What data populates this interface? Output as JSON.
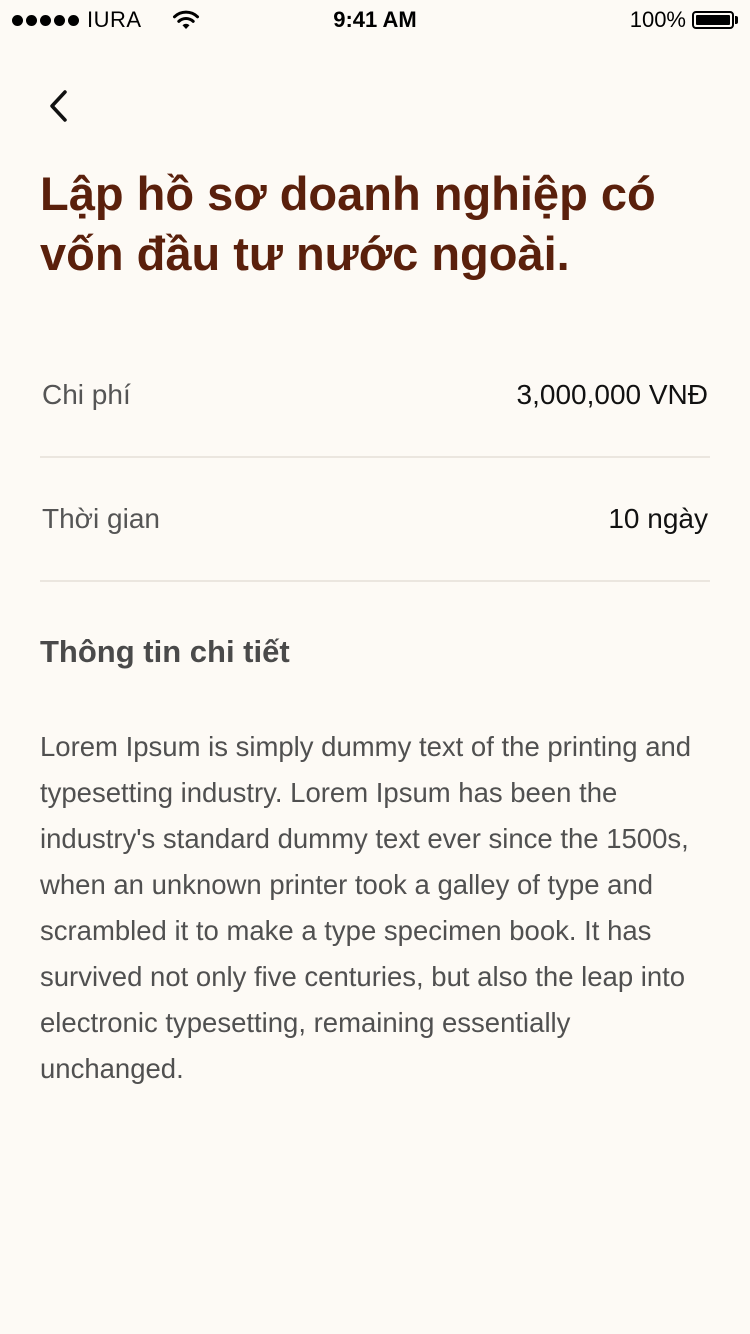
{
  "status_bar": {
    "carrier": "IURA",
    "time": "9:41 AM",
    "battery": "100%"
  },
  "icons": {
    "back": "chevron-left-icon",
    "signal": "signal-dots-icon",
    "wifi": "wifi-icon",
    "battery": "battery-icon"
  },
  "colors": {
    "title": "#5a200c",
    "background": "#fdfaf5",
    "divider": "#ebe6df"
  },
  "page": {
    "title": "Lập hồ sơ doanh nghiệp có vốn đầu tư nước ngoài."
  },
  "info": {
    "cost_label": "Chi phí",
    "cost_value": "3,000,000 VNĐ",
    "time_label": "Thời gian",
    "time_value": "10 ngày"
  },
  "details": {
    "heading": "Thông tin chi tiết",
    "body": "Lorem Ipsum is simply dummy text of the printing and typesetting industry. Lorem Ipsum has been the industry's standard dummy text ever since the 1500s, when an unknown printer took a galley of type and scrambled it to make a type specimen book. It has survived not only five centuries, but also the leap into electronic typesetting, remaining essentially unchanged."
  }
}
